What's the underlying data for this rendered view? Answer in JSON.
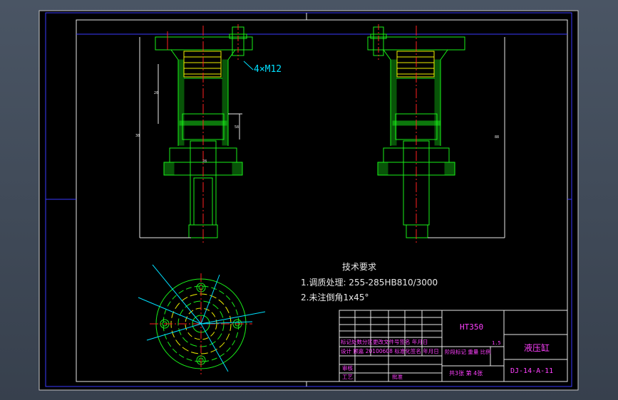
{
  "drawing": {
    "bolt_label": "4×M12",
    "tech_title": "技术要求",
    "tech_req_1": "1.调质处理: 255-285HB810/3000",
    "tech_req_2": "2.未注倒角1x45°",
    "dim_labels": [
      "20",
      "38",
      "28",
      "58",
      "88"
    ]
  },
  "title_block": {
    "material": "HT350",
    "part_name": "液压缸",
    "drawing_no": "DJ-14-A-11",
    "header_row": "标记处数分区更改文件号签名 年月日",
    "design_row": "设计 顾嘉 20100608 标准化签名 年月日",
    "stage_row": "阶段标记  重量  比例",
    "scale": "1.5",
    "sheet_info": "共3张 第 4张",
    "review_label": "审核",
    "process_label": "工艺",
    "approve_label": "批准"
  },
  "colors": {
    "paper": "#000000",
    "line": "#19f019",
    "yellow": "#f0f000",
    "cyan": "#00e0ff",
    "red": "#ff2020",
    "magenta": "#ff40ff",
    "white": "#e8e8e8",
    "frame_blue": "#3a3aff"
  }
}
